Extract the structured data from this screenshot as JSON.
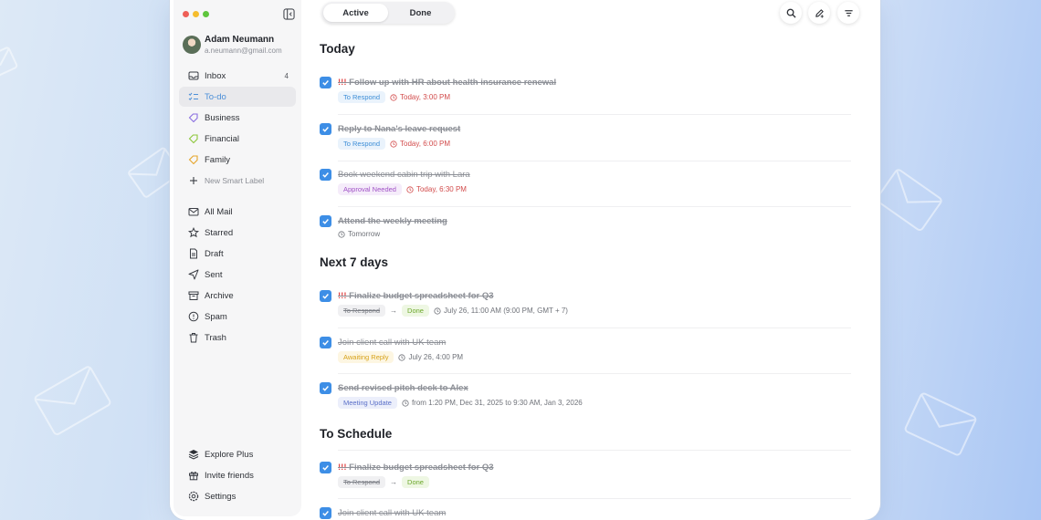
{
  "profile": {
    "name": "Adam Neumann",
    "email": "a.neumann@gmail.com"
  },
  "sidebar": {
    "items": [
      {
        "label": "Inbox",
        "count": "4"
      },
      {
        "label": "To-do"
      },
      {
        "label": "Business"
      },
      {
        "label": "Financial"
      },
      {
        "label": "Family"
      },
      {
        "label": "New Smart Label"
      },
      {
        "label": "All Mail"
      },
      {
        "label": "Starred"
      },
      {
        "label": "Draft"
      },
      {
        "label": "Sent"
      },
      {
        "label": "Archive"
      },
      {
        "label": "Spam"
      },
      {
        "label": "Trash"
      }
    ],
    "bottom": [
      {
        "label": "Explore Plus"
      },
      {
        "label": "Invite friends"
      },
      {
        "label": "Settings"
      }
    ]
  },
  "tabs": {
    "active": "Active",
    "done": "Done"
  },
  "sections": {
    "today": "Today",
    "next7": "Next 7 days",
    "schedule": "To Schedule"
  },
  "tasks": [
    {
      "priority": "!!!",
      "title": "Follow up with HR about health insurance renewal",
      "tag": "To Respond",
      "time": "Today, 3:00 PM"
    },
    {
      "title": "Reply to Nana's leave request",
      "tag": "To Respond",
      "time": "Today, 6:00 PM"
    },
    {
      "title": "Book weekend cabin trip with Lara",
      "tag": "Approval Needed",
      "time": "Today, 6:30 PM"
    },
    {
      "title": "Attend the weekly meeting",
      "time": "Tomorrow"
    },
    {
      "priority": "!!!",
      "title": "Finalize budget spreadsheet for Q3",
      "tag_from": "To Respond",
      "arrow": "→",
      "tag": "Done",
      "time": "July 26, 11:00 AM (9:00 PM, GMT + 7)"
    },
    {
      "title": "Join client call with UK team",
      "tag": "Awaiting Reply",
      "time": "July 26, 4:00 PM"
    },
    {
      "title": "Send revised pitch deck to Alex",
      "tag": "Meeting Update",
      "time": "from 1:20 PM, Dec 31, 2025 to 9:30 AM, Jan 3, 2026"
    },
    {
      "priority": "!!!",
      "title": "Finalize budget spreadsheet for Q3",
      "tag_from": "To Respond",
      "arrow": "→",
      "tag": "Done"
    },
    {
      "title": "Join client call with UK team"
    }
  ],
  "colors": {
    "accent": "#3d8ee6",
    "priority": "#e24a4a",
    "overdue_time": "#d24b4b"
  }
}
